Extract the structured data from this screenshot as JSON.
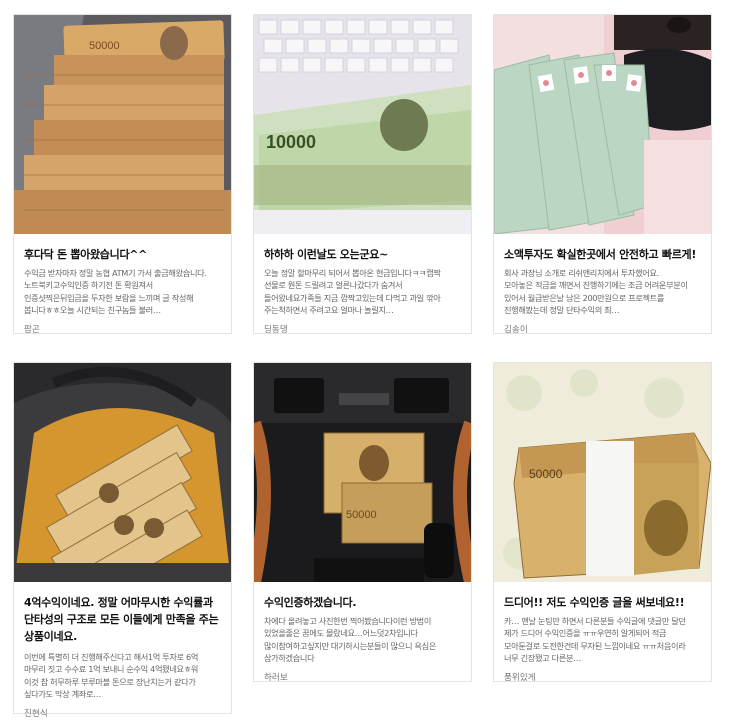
{
  "cards": [
    {
      "title": "후다닥 돈 뽑아왔습니다^^",
      "desc": "수익금 받자마자 정말 농협 ATM기 가서 출금해왔습니다.\n노트북키고수익인증 하기전 돈 확원져서\n인증샷찍은뒤입금을 두자한 보람을 느끼며 글 작성해\n봅니다ㅎㅎ오늘 시간되는 친구놈들 불러…",
      "author": "팜곤",
      "image": "cash-on-laptop-photo"
    },
    {
      "title": "하하하 이런날도 오는군요~",
      "desc": "오늘 정말 할마무리 되어서 뽑아온 현금입니다ㅋㅋ캡짝\n선물로 뭔돈 드릴려고 얼른나갔다가 숨겨서\n돌어왔네요가족들 지금 깜짝고있는데 다먹고 과일 깎아\n주는척하면서 주려고요 얼마나 놀릴지…",
      "author": "딩동댕",
      "image": "cash-on-keyboard-photo"
    },
    {
      "title": "소액투자도 확실한곳에서 안전하고 빠르게!",
      "desc": "회사 과장님 소개로 리쉬앤리치에서 투자했어요.\n모아놓은 적금을 깨면서 진행하기에는 조금 어려운부분이\n있어서 월급받은날 남은 200만원으로 프로젝트를\n진행해봤는데 정말 단타수익의 최…",
      "author": "김송이",
      "image": "woman-holding-cash-photo"
    },
    {
      "title": "4억수익이네요. 정말 어마무시한 수익률과 단타성의 구조로 모든 이들에게 만족을 주는 상품이네요.",
      "desc": "이번에 특별히 더 진행해주신다고 해서1억 투자로 6억\n마무리 짓고 수수료 1억 보내니 순수익 4억됐네요ㅎ워\n이것 참 허무하루 부루마블 돈으로 장난치는거 같다가\n싶다가도 막상 계좌로…",
      "author": "진현식",
      "image": "bag-of-cash-photo"
    },
    {
      "title": "수익인증하겠습니다.",
      "desc": "차에다 올려놓고 사진한번 찍어봤습니다이런 방법이\n있었을줄은 꿈에도 몰랐네요…어느덧2차입니다\n많이참여하고싶지만 대기하시는분들이 많으니 욕심은\n삼가하겠습니다",
      "author": "하러보",
      "image": "cash-in-car-photo"
    },
    {
      "title": "드디어!! 저도 수익인증 글을 써보네요!!",
      "desc": "카… 맨날 눈팅만 하면서 다른분들 수익글에 댓글만 달던\n제가 드디어 수익인증을 ㅠㅠ우연히 알게되어 적금\n모아둔걸로 도전한건데 무자된 느낌이네요 ㅠㅠ처음이라\n너무 긴장됐고 다른분…",
      "author": "품위있게",
      "image": "cash-bundles-on-bed-photo"
    }
  ],
  "colors": {
    "border": "#e3e3e3",
    "title": "#111111",
    "desc": "#666666",
    "author": "#777777"
  }
}
